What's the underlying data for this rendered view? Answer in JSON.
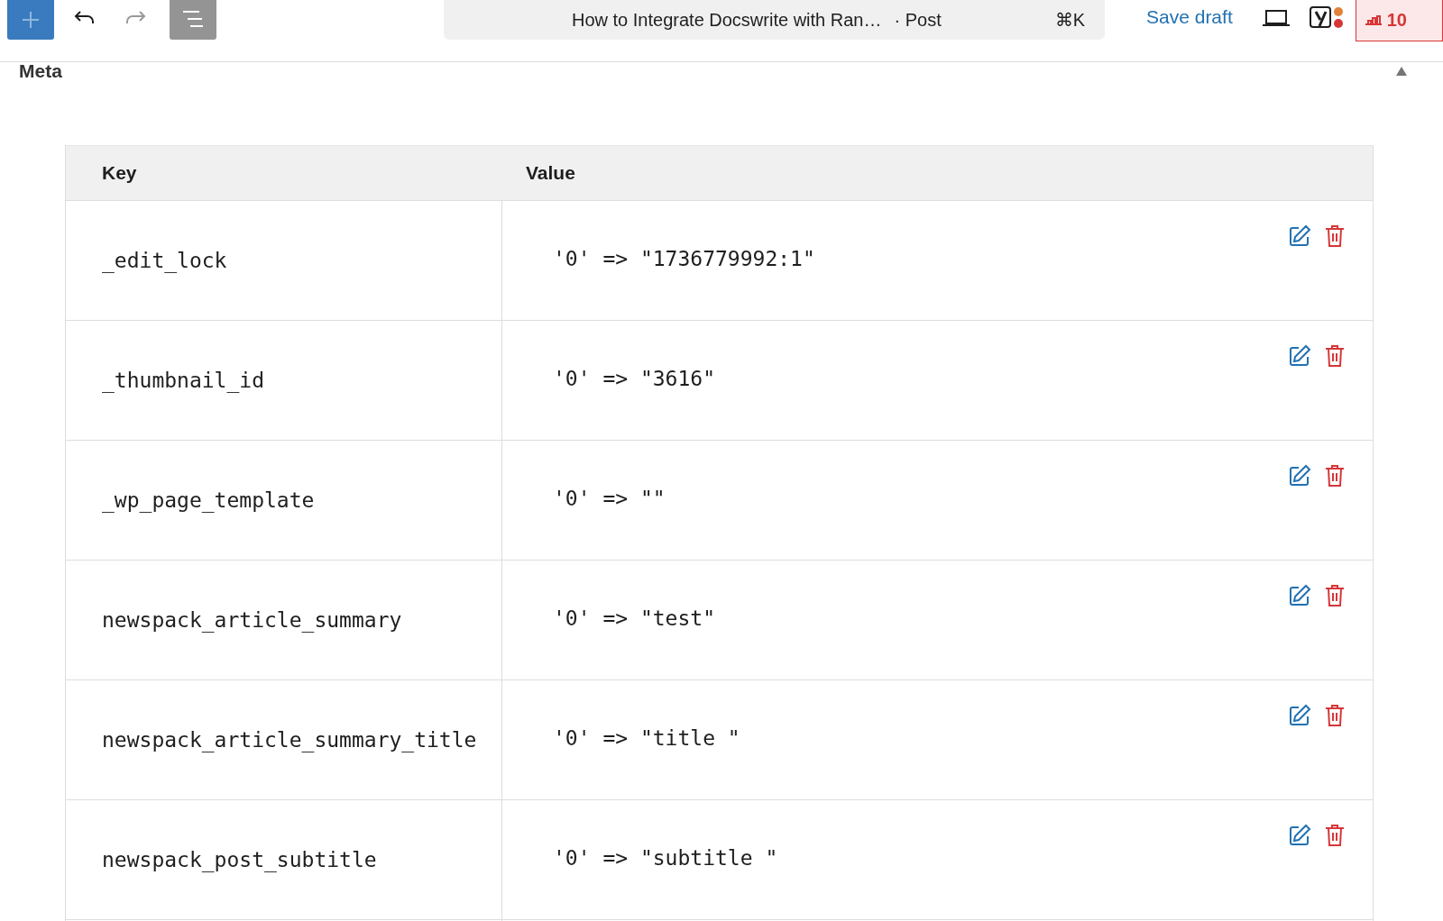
{
  "toolbar": {
    "document_title": "How to Integrate Docswrite with Ran…",
    "document_type": "· Post",
    "shortcut": "⌘K",
    "save_label": "Save draft",
    "badge_count": "10"
  },
  "panel": {
    "title": "Meta",
    "expanded": true
  },
  "table": {
    "columns": [
      "Key",
      "Value"
    ],
    "rows": [
      {
        "key": "_edit_lock",
        "value": "'0' => \"1736779992:1\""
      },
      {
        "key": "_thumbnail_id",
        "value": "'0' => \"3616\""
      },
      {
        "key": "_wp_page_template",
        "value": "'0' => \"\""
      },
      {
        "key": "newspack_article_summary",
        "value": "'0' => \"test\""
      },
      {
        "key": "newspack_article_summary_title",
        "value": "'0' => \"title \""
      },
      {
        "key": "newspack_post_subtitle",
        "value": "'0' => \"subtitle \""
      }
    ]
  }
}
